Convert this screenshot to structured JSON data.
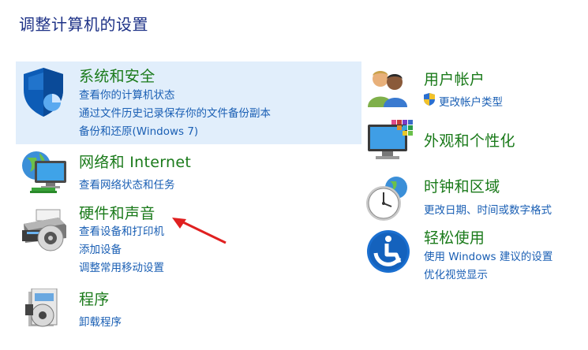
{
  "page": {
    "title": "调整计算机的设置"
  },
  "left": [
    {
      "title": "系统和安全",
      "icon": "shield-icon",
      "links": [
        "查看你的计算机状态",
        "通过文件历史记录保存你的文件备份副本",
        "备份和还原(Windows 7)"
      ]
    },
    {
      "title": "网络和 Internet",
      "icon": "network-icon",
      "links": [
        "查看网络状态和任务"
      ]
    },
    {
      "title": "硬件和声音",
      "icon": "printer-icon",
      "links": [
        "查看设备和打印机",
        "添加设备",
        "调整常用移动设置"
      ]
    },
    {
      "title": "程序",
      "icon": "programs-icon",
      "links": [
        "卸载程序"
      ]
    }
  ],
  "right": [
    {
      "title": "用户帐户",
      "icon": "users-icon",
      "links": [
        "更改帐户类型"
      ]
    },
    {
      "title": "外观和个性化",
      "icon": "monitor-icon",
      "links": []
    },
    {
      "title": "时钟和区域",
      "icon": "clock-icon",
      "links": [
        "更改日期、时间或数字格式"
      ]
    },
    {
      "title": "轻松使用",
      "icon": "accessibility-icon",
      "links": [
        "使用 Windows 建议的设置",
        "优化视觉显示"
      ]
    }
  ],
  "colors": {
    "title": "#1e3287",
    "category": "#1a7a1a",
    "link": "#1a5fb4",
    "highlight": "#e1eefb",
    "arrow": "#e02020"
  },
  "annotation": {
    "icon": "red-arrow-icon"
  }
}
